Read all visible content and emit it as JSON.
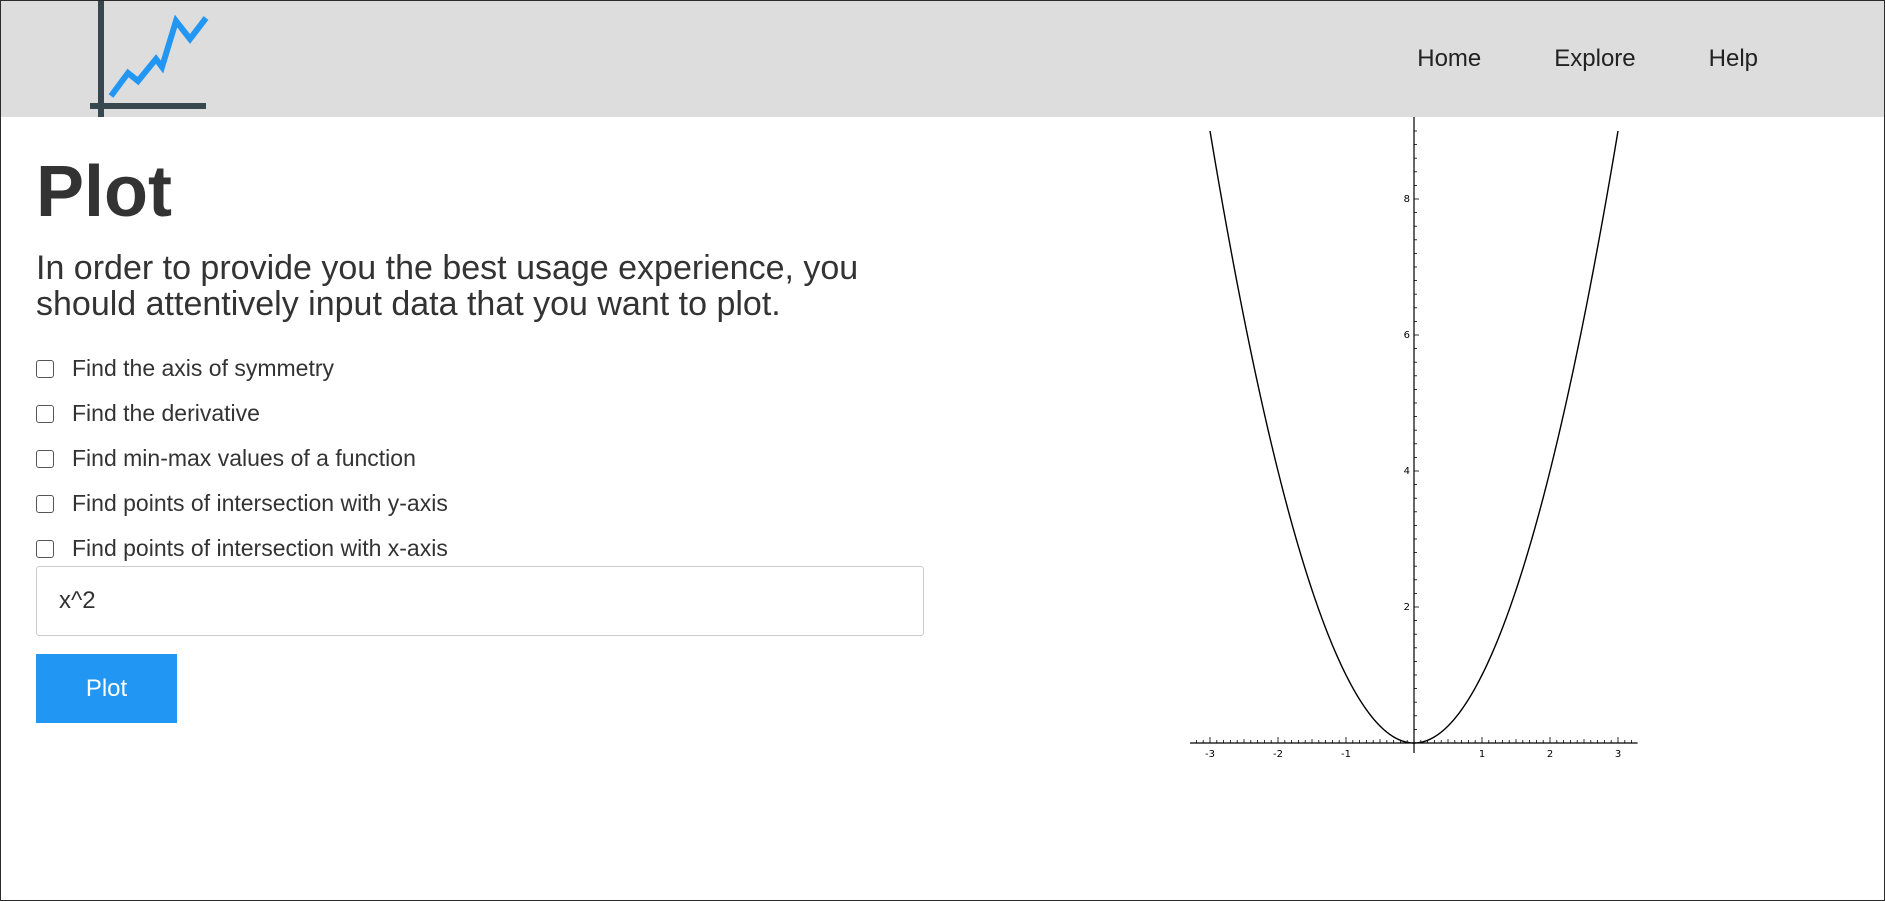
{
  "header": {
    "nav": [
      {
        "label": "Home"
      },
      {
        "label": "Explore"
      },
      {
        "label": "Help"
      }
    ],
    "logo_icon": "line-chart-icon",
    "logo_line_color": "#2196F3",
    "logo_axis_color": "#37474F"
  },
  "main": {
    "title": "Plot",
    "intro": "In order to provide you the best usage experience, you should attentively input data that you want to plot.",
    "options": [
      {
        "label": "Find the axis of symmetry",
        "checked": false
      },
      {
        "label": "Find the derivative",
        "checked": false
      },
      {
        "label": "Find min-max values of a function",
        "checked": false
      },
      {
        "label": "Find points of intersection with y-axis",
        "checked": false
      },
      {
        "label": "Find points of intersection with x-axis",
        "checked": false
      }
    ],
    "function_input": {
      "value": "x^2",
      "placeholder": ""
    },
    "plot_button": "Plot",
    "accent_color": "#2196F3"
  },
  "chart_data": {
    "type": "line",
    "function": "x^2",
    "series": [
      {
        "x": [
          -3,
          -2.5,
          -2,
          -1.5,
          -1,
          -0.5,
          0,
          0.5,
          1,
          1.5,
          2,
          2.5,
          3
        ],
        "y": [
          9,
          6.25,
          4,
          2.25,
          1,
          0.25,
          0,
          0.25,
          1,
          2.25,
          4,
          6.25,
          9
        ]
      }
    ],
    "xlim": [
      -3.2,
      3.2
    ],
    "ylim": [
      0,
      9.2
    ],
    "x_tick_labels": [
      "-3",
      "-2",
      "-1",
      "1",
      "2",
      "3"
    ],
    "y_tick_labels": [
      "2",
      "4",
      "6",
      "8"
    ],
    "grid": false,
    "line_color": "#000000"
  }
}
